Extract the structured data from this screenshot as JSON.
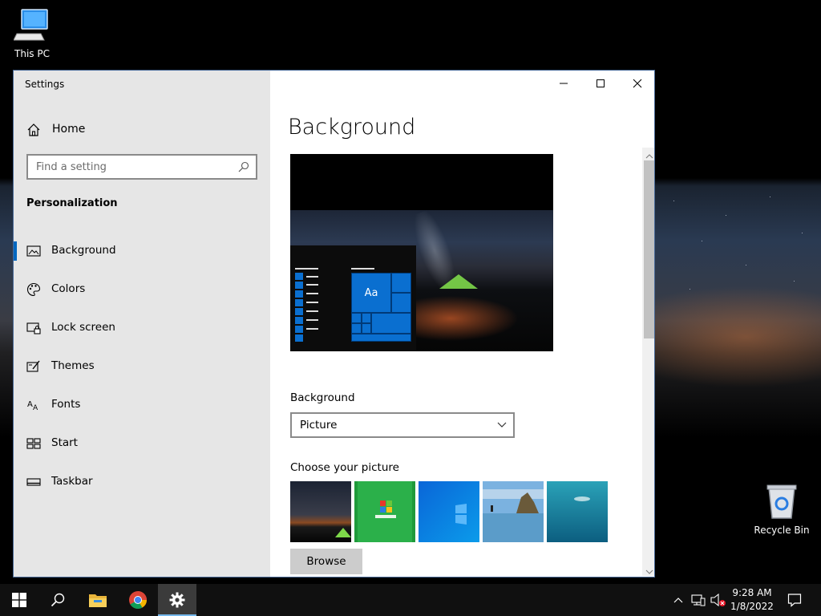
{
  "desktop": {
    "icons": [
      {
        "label": "This PC",
        "icon": "computer-icon"
      },
      {
        "label": "Recycle Bin",
        "icon": "recycle-bin-icon"
      }
    ]
  },
  "window": {
    "title": "Settings",
    "controls": {
      "minimize": "minimize-icon",
      "maximize": "maximize-icon",
      "close": "close-icon"
    }
  },
  "sidebar": {
    "home_label": "Home",
    "search_placeholder": "Find a setting",
    "section_title": "Personalization",
    "items": [
      {
        "label": "Background",
        "icon": "picture-icon",
        "active": true
      },
      {
        "label": "Colors",
        "icon": "palette-icon"
      },
      {
        "label": "Lock screen",
        "icon": "lock-screen-icon"
      },
      {
        "label": "Themes",
        "icon": "themes-icon"
      },
      {
        "label": "Fonts",
        "icon": "fonts-icon"
      },
      {
        "label": "Start",
        "icon": "start-icon"
      },
      {
        "label": "Taskbar",
        "icon": "taskbar-icon"
      }
    ]
  },
  "main": {
    "page_title": "Background",
    "preview_tile_text": "Aa",
    "background_label": "Background",
    "background_value": "Picture",
    "choose_label": "Choose your picture",
    "browse_label": "Browse"
  },
  "taskbar": {
    "clock_time": "9:28 AM",
    "clock_date": "1/8/2022"
  },
  "colors": {
    "accent": "#0067c0",
    "tile_blue": "#0a6fd0",
    "sidebar_bg": "#e6e6e6",
    "taskbar_bg": "#101010"
  }
}
